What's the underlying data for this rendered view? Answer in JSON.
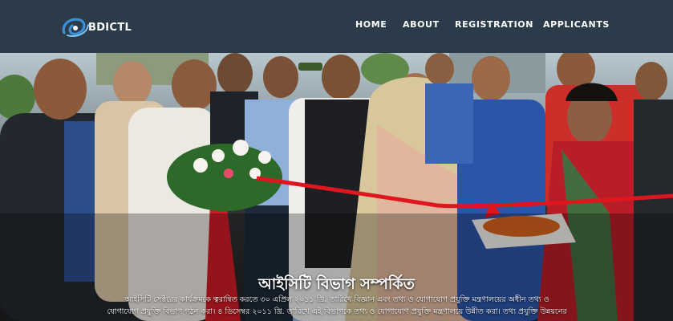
{
  "brand": {
    "name": "BDICTL",
    "accent": "#4aa3df"
  },
  "nav": {
    "items": [
      {
        "label": "HOME"
      },
      {
        "label": "ABOUT"
      },
      {
        "label": "REGISTRATION"
      },
      {
        "label": "APPLICANTS"
      }
    ]
  },
  "hero": {
    "title": "আইসিটি বিভাগ সম্পর্কিত",
    "text_lines": [
      "আইসিটি সেক্টরের কার্যক্রমকে ত্বরান্বিত করতে ৩০ এপ্রিল ২০১১ খ্রি. তারিখে বিজ্ঞান এবং তথ্য ও যোগাযোগ প্রযুক্তি মন্ত্রণালয়ের অধীন তথ্য ও",
      "যোগাযোগ প্রযুক্তি বিভাগ গঠন করা। ৪ ডিসেম্বর ২০১১ খ্রি. তারিখে এই বিভাগকে তথ্য ও যোগাযোগ প্রযুক্তি মন্ত্রণালয়ে উন্নীত করা। তথ্য প্রযুক্তি উন্নয়নের"
    ]
  },
  "colors": {
    "navbar": "#2c3b4a",
    "ribbon": "#e0161e",
    "nav_text": "#ffffff"
  }
}
